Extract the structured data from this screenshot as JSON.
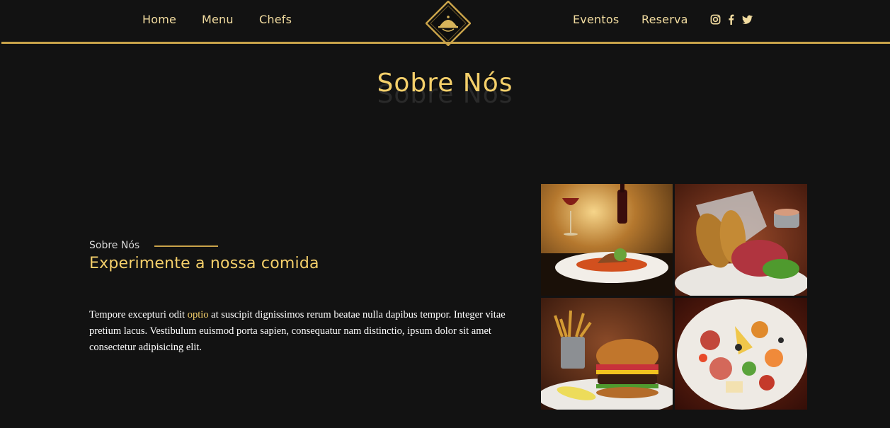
{
  "nav": {
    "left_links": [
      "Home",
      "Menu",
      "Chefs"
    ],
    "right_links": [
      "Eventos",
      "Reserva"
    ],
    "social": [
      "instagram-icon",
      "facebook-icon",
      "twitter-icon"
    ],
    "accent": "#c9a34a"
  },
  "hero": {
    "title": "Sobre Nós",
    "title_color": "#f4cf6a"
  },
  "about": {
    "eyebrow": "Sobre Nós",
    "heading": "Experimente a nossa comida",
    "para_before": "Tempore excepturi odit ",
    "para_highlight": "optio",
    "para_after": " at suscipit dignissimos rerum beatae nulla dapibus tempor. Integer vitae pretium lacus. Vestibulum euismod porta sapien, consequatur nam distinctio, ipsum dolor sit amet consectetur adipisicing elit."
  },
  "gallery": {
    "images": [
      "steak-dinner-with-wine",
      "fried-chicken-basket",
      "burger-with-fries",
      "antipasto-platter"
    ]
  }
}
